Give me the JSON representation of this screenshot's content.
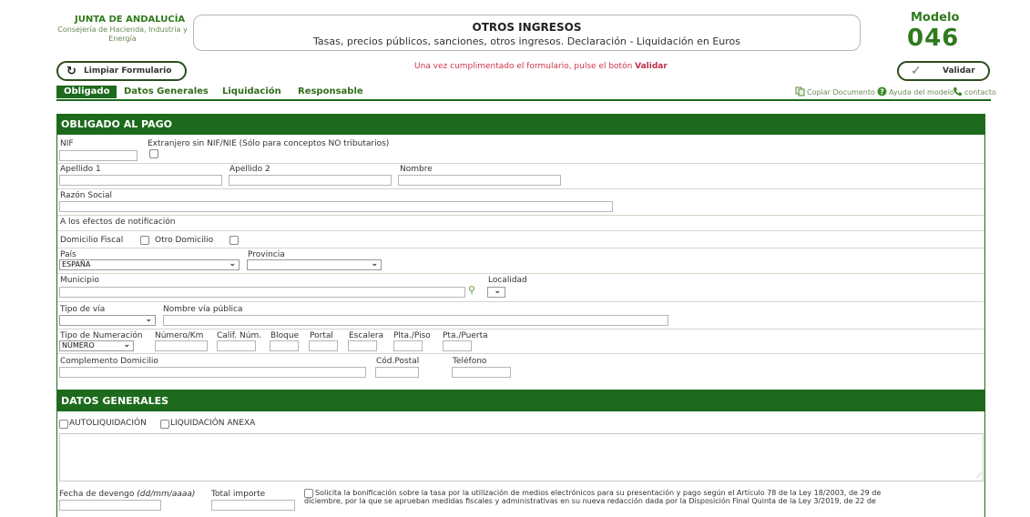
{
  "header": {
    "org_title": "JUNTA DE ANDALUCÍA",
    "org_subtitle": "Consejería de Hacienda, Industria y Energía",
    "form_title": "OTROS INGRESOS",
    "form_subtitle": "Tasas, precios públicos, sanciones, otros ingresos. Declaración - Liquidación en Euros",
    "modelo_label": "Modelo",
    "modelo_number": "046"
  },
  "toolbar": {
    "clear_label": "Limpiar Formulario",
    "notice_text": "Una vez cumplimentado el formulario, pulse el botón ",
    "notice_highlight": "Validar",
    "validate_label": "Validar"
  },
  "tabs": [
    {
      "label": "Obligado",
      "active": true
    },
    {
      "label": "Datos Generales",
      "active": false
    },
    {
      "label": "Liquidación",
      "active": false
    },
    {
      "label": "Responsable",
      "active": false
    }
  ],
  "links": {
    "copy": "Copiar Documento",
    "help": "Ayuda del modelo",
    "contact": "contacto"
  },
  "obligado": {
    "title": "OBLIGADO AL PAGO",
    "nif": "NIF",
    "extranjero": "Extranjero sin NIF/NIE (Sólo para conceptos NO tributarios)",
    "apellido1": "Apellido 1",
    "apellido2": "Apellido 2",
    "nombre": "Nombre",
    "razon_social": "Razón Social",
    "notificacion": "A los efectos de notificación",
    "domicilio_fiscal": "Domicilio Fiscal",
    "otro_domicilio": "Otro Domicilio",
    "pais": "País",
    "pais_value": "ESPAÑA",
    "provincia": "Provincia",
    "municipio": "Municipio",
    "localidad": "Localidad",
    "tipo_via": "Tipo de vía",
    "nombre_via": "Nombre vía pública",
    "tipo_numeracion": "Tipo de Numeración",
    "tipo_numeracion_value": "NÚMERO",
    "numero_km": "Número/Km",
    "calif_num": "Calif. Núm.",
    "bloque": "Bloque",
    "portal": "Portal",
    "escalera": "Escalera",
    "plta_piso": "Plta./Piso",
    "pta_puerta": "Pta./Puerta",
    "complemento": "Complemento Domicilio",
    "cod_postal": "Cód.Postal",
    "telefono": "Teléfono"
  },
  "datos_generales": {
    "title": "DATOS GENERALES",
    "autoliquidacion": "AUTOLIQUIDACIÓN",
    "liquidacion_anexa": "LIQUIDACIÓN ANEXA",
    "fecha_devengo": "Fecha de devengo",
    "fecha_format": "(dd/mm/aaaa)",
    "total_importe": "Total importe",
    "bonificacion_line1": "Solicita la bonificación sobre la tasa por la utilización de medios electrónicos para su presentación y pago según el Artículo 78 de la Ley 18/2003, de 29 de",
    "bonificacion_line2": "diciembre, por la que se aprueban medidas fiscales y administrativas en su nueva redacción dada por la Disposición Final Quinta de la Ley 3/2019, de 22 de"
  },
  "colors": {
    "brand_green": "#1d6a1d",
    "title_green": "#2f7a1c",
    "notice_red": "#d0354a"
  },
  "icons": {
    "clear": "refresh-icon",
    "validate": "checkmark-icon",
    "copy": "copy-document-icon",
    "help": "help-icon",
    "contact": "phone-icon",
    "search": "magnifier-icon"
  }
}
